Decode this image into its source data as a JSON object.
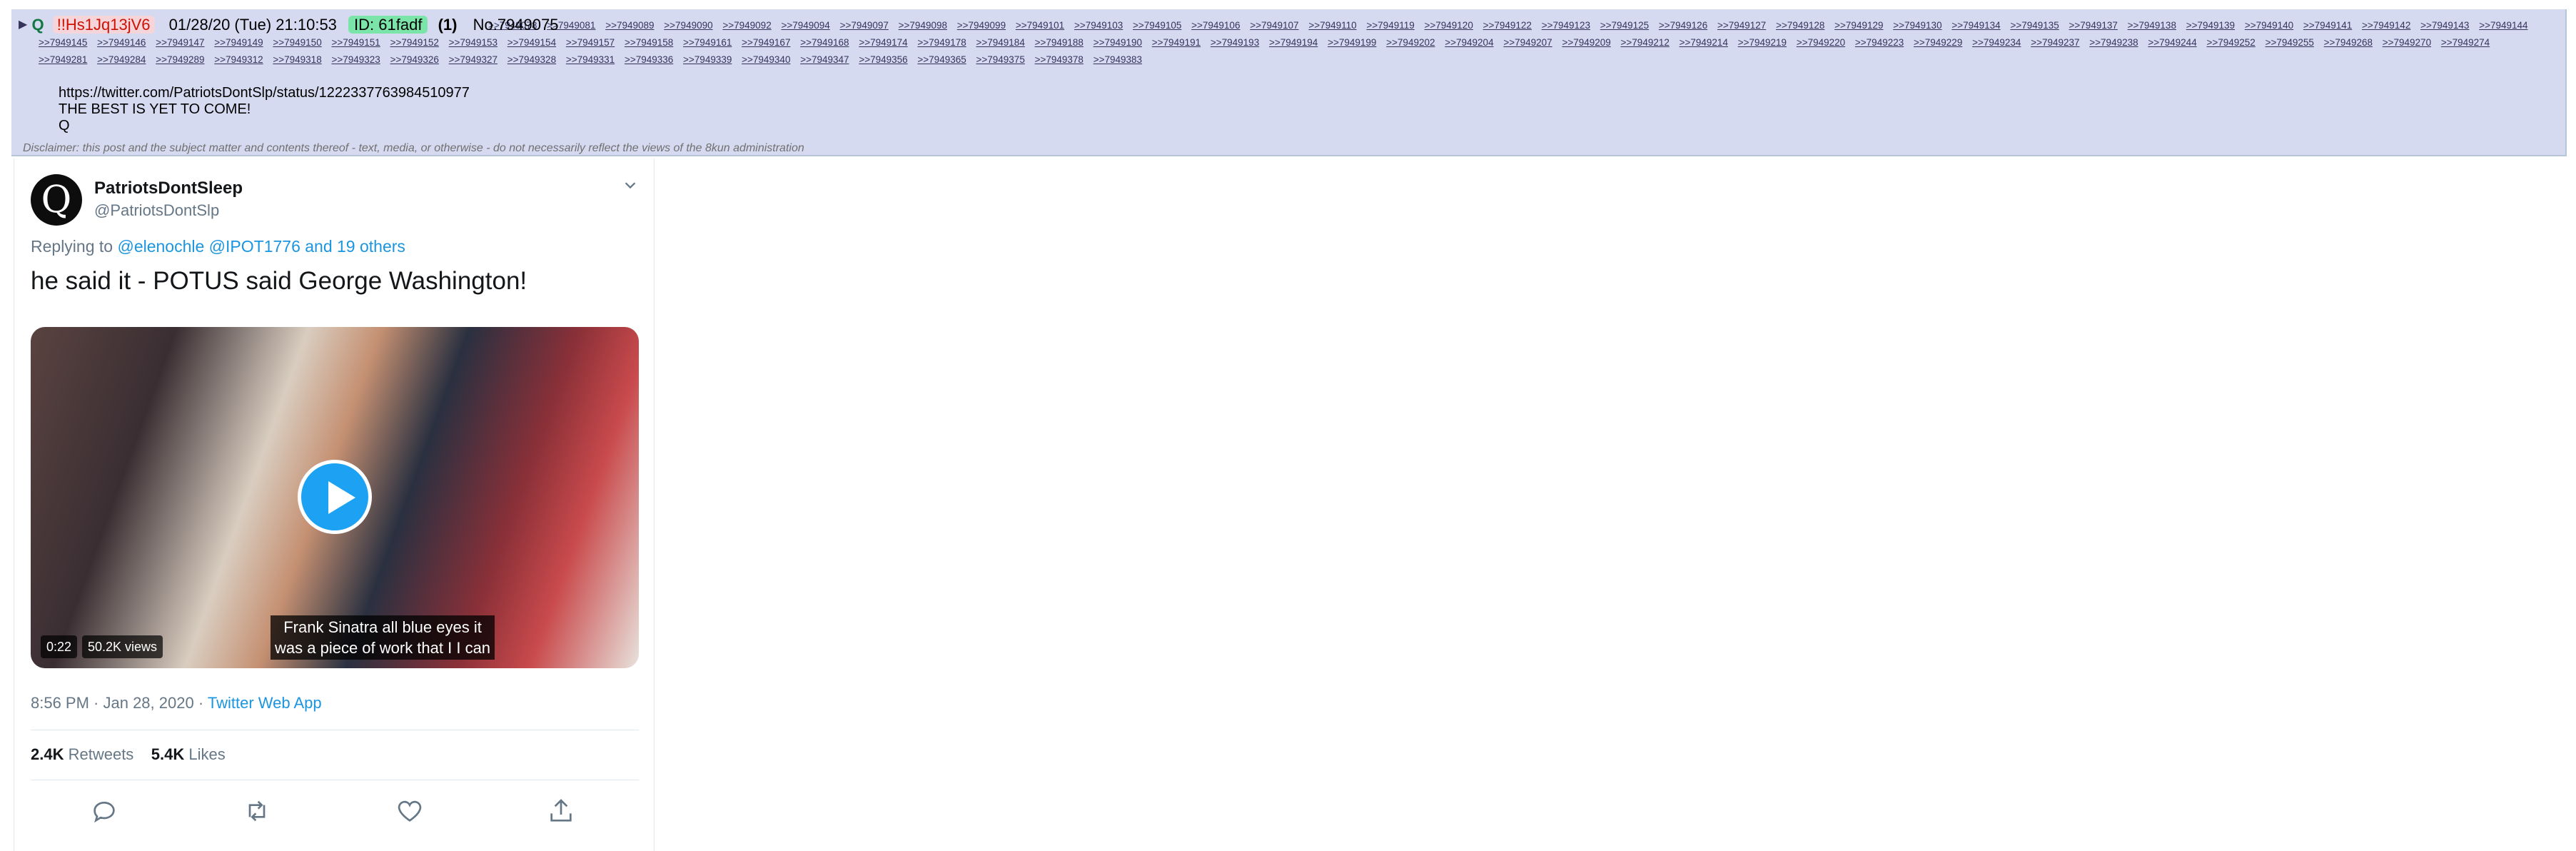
{
  "post": {
    "arrow": "▶",
    "name": "Q",
    "tripcode": "!!Hs1Jq13jV6",
    "datetime": "01/28/20 (Tue) 21:10:53",
    "id_label": "ID: 61fadf",
    "count": "(1)",
    "post_no": "No.7949075",
    "backlinks": [
      ">>7949078",
      ">>7949081",
      ">>7949089",
      ">>7949090",
      ">>7949092",
      ">>7949094",
      ">>7949097",
      ">>7949098",
      ">>7949099",
      ">>7949101",
      ">>7949103",
      ">>7949105",
      ">>7949106",
      ">>7949107",
      ">>7949110",
      ">>7949119",
      ">>7949120",
      ">>7949122",
      ">>7949123",
      ">>7949125",
      ">>7949126",
      ">>7949127",
      ">>7949128",
      ">>7949129",
      ">>7949130",
      ">>7949134",
      ">>7949135",
      ">>7949137",
      ">>7949138",
      ">>7949139",
      ">>7949140",
      ">>7949141",
      ">>7949142",
      ">>7949143",
      ">>7949144",
      ">>7949145",
      ">>7949146",
      ">>7949147",
      ">>7949149",
      ">>7949150",
      ">>7949151",
      ">>7949152",
      ">>7949153",
      ">>7949154",
      ">>7949157",
      ">>7949158",
      ">>7949161",
      ">>7949167",
      ">>7949168",
      ">>7949174",
      ">>7949178",
      ">>7949184",
      ">>7949188",
      ">>7949190",
      ">>7949191",
      ">>7949193",
      ">>7949194",
      ">>7949199",
      ">>7949202",
      ">>7949204",
      ">>7949207",
      ">>7949209",
      ">>7949212",
      ">>7949214",
      ">>7949219",
      ">>7949220",
      ">>7949223",
      ">>7949229",
      ">>7949234",
      ">>7949237",
      ">>7949238",
      ">>7949244",
      ">>7949252",
      ">>7949255",
      ">>7949268",
      ">>7949270",
      ">>7949274",
      ">>7949281",
      ">>7949284",
      ">>7949289",
      ">>7949312",
      ">>7949318",
      ">>7949323",
      ">>7949326",
      ">>7949327",
      ">>7949328",
      ">>7949331",
      ">>7949336",
      ">>7949339",
      ">>7949340",
      ">>7949347",
      ">>7949356",
      ">>7949365",
      ">>7949375",
      ">>7949378",
      ">>7949383"
    ],
    "body_lines": [
      "https://twitter.com/PatriotsDontSlp/status/1222337763984510977",
      "THE BEST IS YET TO COME!",
      "Q"
    ],
    "disclaimer": "Disclaimer: this post and the subject matter and contents thereof - text, media, or otherwise - do not necessarily reflect the views of the 8kun administration"
  },
  "tweet": {
    "avatar_letter": "Q",
    "display_name": "PatriotsDontSleep",
    "handle": "@PatriotsDontSlp",
    "more_icon": "chevron-down-icon",
    "replying_prefix": "Replying to ",
    "replying_to": "@elenochle @IPOT1776 and 19 others",
    "text": "he said it - POTUS said George Washington!",
    "video": {
      "caption_line1": "Frank Sinatra all blue eyes it",
      "caption_line2": "was a piece of work that I I can",
      "duration": "0:22",
      "views": "50.2K views"
    },
    "timestamp": "8:56 PM · Jan 28, 2020 · ",
    "source": "Twitter Web App",
    "retweets_count": "2.4K",
    "retweets_label": " Retweets",
    "likes_count": "5.4K",
    "likes_label": " Likes",
    "actions": [
      "reply-icon",
      "retweet-icon",
      "like-icon",
      "share-icon"
    ]
  },
  "colors": {
    "post_bg": "#d6daf0",
    "name": "#117743",
    "trip": "#cc1105",
    "id_bg": "#7be4a8",
    "twitter_blue": "#1b95e0"
  }
}
